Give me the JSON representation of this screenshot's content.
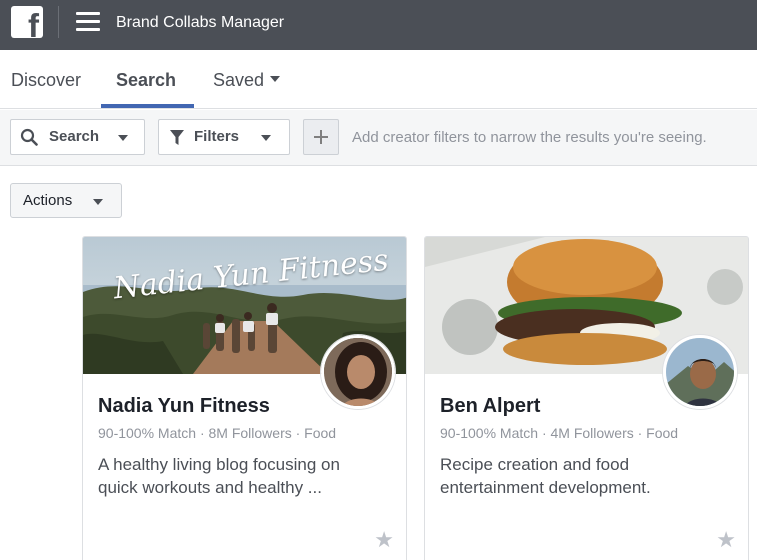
{
  "header": {
    "logo_letter": "f",
    "title": "Brand Collabs Manager"
  },
  "tabs": [
    {
      "label": "Discover"
    },
    {
      "label": "Search"
    },
    {
      "label": "Saved"
    }
  ],
  "filterbar": {
    "search_label": "Search",
    "filters_label": "Filters",
    "hint": "Add creator filters to narrow the results you're seeing."
  },
  "actions_label": "Actions",
  "creators": [
    {
      "name": "Nadia Yun Fitness",
      "meta": "90-100% Match · 8M Followers · Food",
      "description": "A healthy living blog focusing on quick workouts and healthy ...",
      "cover_text": "Nadia Yun Fitness"
    },
    {
      "name": "Ben Alpert",
      "meta": "90-100% Match · 4M Followers · Food",
      "description": "Recipe creation and food entertainment development."
    }
  ],
  "colors": {
    "topbar": "#4b4f56",
    "accent": "#4267b2"
  }
}
